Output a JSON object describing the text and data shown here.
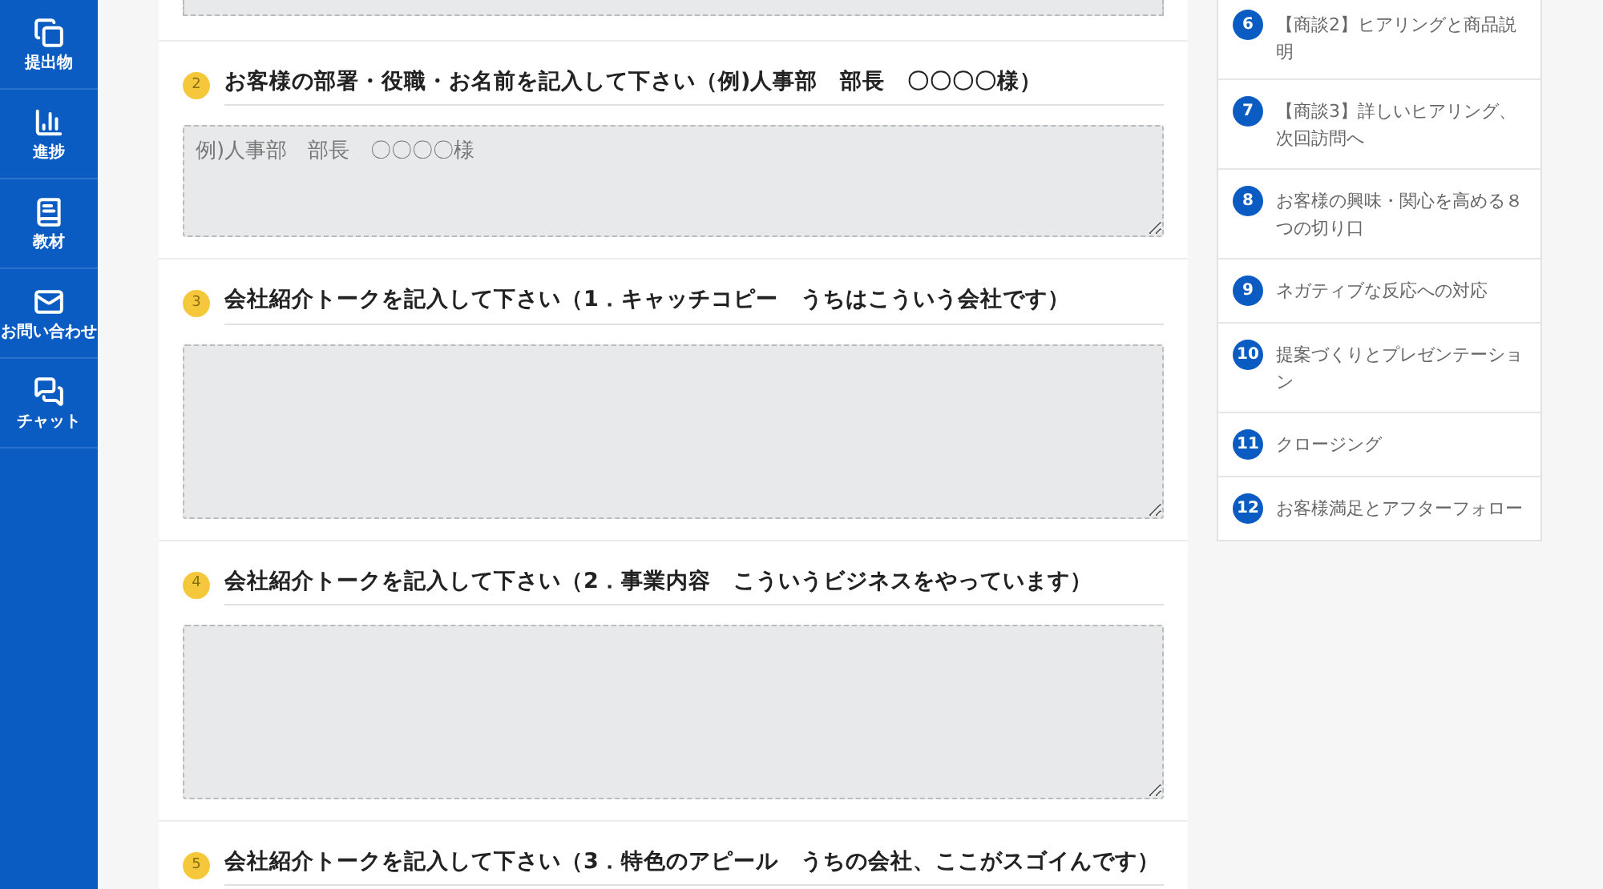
{
  "sidebar": {
    "items": [
      {
        "kind": "files",
        "label": "提出物"
      },
      {
        "kind": "chart",
        "label": "進捗"
      },
      {
        "kind": "book",
        "label": "教材"
      },
      {
        "kind": "mail",
        "label": "お問い合わせ"
      },
      {
        "kind": "chat",
        "label": "チャット"
      }
    ]
  },
  "form": {
    "questions": [
      {
        "number": "2",
        "title": "お客様の部署・役職・お名前を記入して下さい（例)人事部　部長　〇〇〇〇様）",
        "placeholder": "例)人事部　部長　〇〇〇〇様"
      },
      {
        "number": "3",
        "title": "会社紹介トークを記入して下さい（1．キャッチコピー　うちはこういう会社です）"
      },
      {
        "number": "4",
        "title": "会社紹介トークを記入して下さい（2．事業内容　こういうビジネスをやっています）"
      },
      {
        "number": "5",
        "title": "会社紹介トークを記入して下さい（3．特色のアピール　うちの会社、ここがスゴイんです）"
      }
    ]
  },
  "chapters": [
    {
      "number": "6",
      "title": "【商談2】ヒアリングと商品説明"
    },
    {
      "number": "7",
      "title": "【商談3】詳しいヒアリング、次回訪問へ"
    },
    {
      "number": "8",
      "title": "お客様の興味・関心を高める８つの切り口"
    },
    {
      "number": "9",
      "title": "ネガティブな反応への対応"
    },
    {
      "number": "10",
      "title": "提案づくりとプレゼンテーション"
    },
    {
      "number": "11",
      "title": "クロージング"
    },
    {
      "number": "12",
      "title": "お客様満足とアフターフォロー"
    }
  ]
}
